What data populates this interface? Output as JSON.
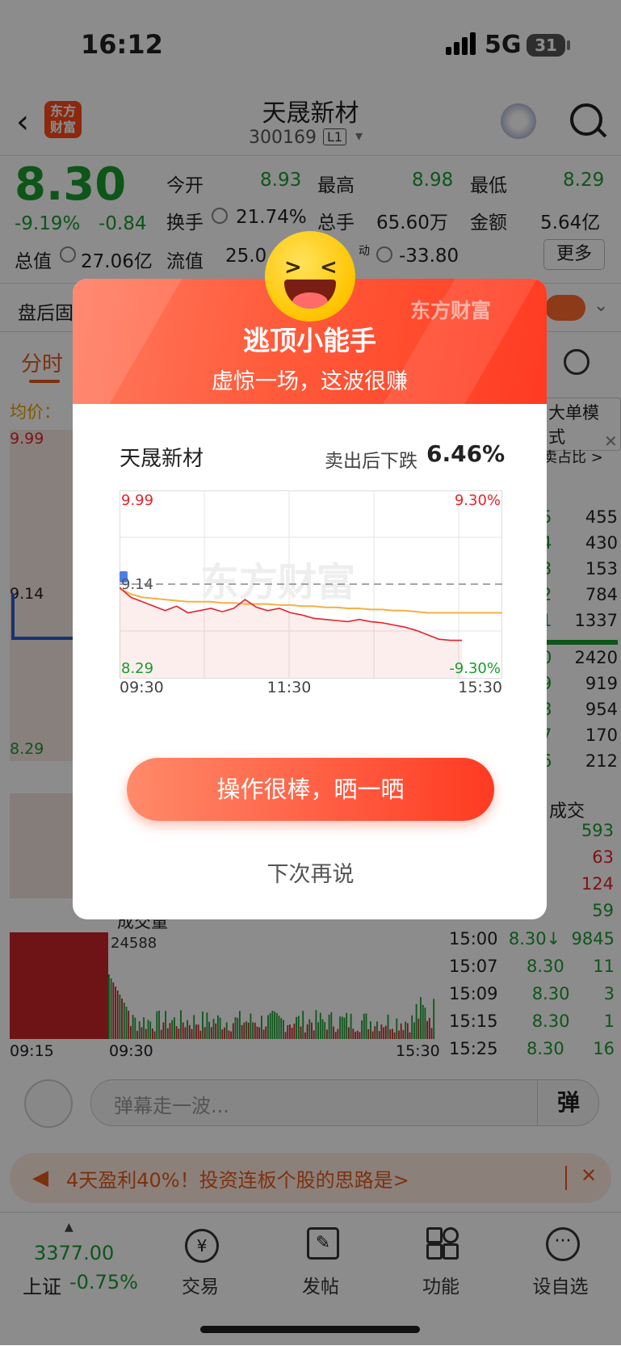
{
  "status_bar": {
    "time": "16:12",
    "network": "5G",
    "battery": "31"
  },
  "header": {
    "logo_text": "东方\n财富",
    "title": "天晟新材",
    "code": "300169",
    "level": "L1"
  },
  "quote": {
    "price": "8.30",
    "change_pct": "-9.19%",
    "change_val": "-0.84",
    "open_label": "今开",
    "open": "8.93",
    "high_label": "最高",
    "high": "8.98",
    "low_label": "最低",
    "low": "8.29",
    "turnover_label": "换手",
    "turnover": "21.74%",
    "volume_label": "总手",
    "volume": "65.60万",
    "amount_label": "金额",
    "amount": "5.64亿",
    "mktcap_label": "总值",
    "mktcap": "27.06亿",
    "float_label": "流值",
    "float": "25.0",
    "flow_label": "动",
    "flow": "-33.80",
    "more": "更多"
  },
  "behind": {
    "after_hours": "盘后固",
    "tab_timeshare": "分时",
    "avg_label": "均价：",
    "mode": "大单模式",
    "ratio": "卖占比 >",
    "y_top": "9.99",
    "y_mid": "9.14",
    "y_bot": "8.29",
    "vol_label": "成交量",
    "vol_max": "24588",
    "t_start": "09:15",
    "t_open": "09:30",
    "t_close": "15:30",
    "ask_vols": [
      "455",
      "430",
      "153",
      "784",
      "1337"
    ],
    "bid_vols": [
      "2420",
      "919",
      "954",
      "170",
      "212"
    ],
    "ask_digits": [
      "5",
      "4",
      "3",
      "2",
      "1"
    ],
    "bid_digits": [
      "0",
      "9",
      "8",
      "7",
      "6"
    ],
    "trades_label": "成交",
    "trades_top": [
      "593",
      "63",
      "124",
      "59"
    ],
    "trades": [
      {
        "time": "15:00",
        "price": "8.30↓",
        "vol": "9845"
      },
      {
        "time": "15:07",
        "price": "8.30",
        "vol": "11"
      },
      {
        "time": "15:09",
        "price": "8.30",
        "vol": "3"
      },
      {
        "time": "15:15",
        "price": "8.30",
        "vol": "1"
      },
      {
        "time": "15:25",
        "price": "8.30",
        "vol": "16"
      }
    ]
  },
  "dialog": {
    "brand": "东方财富",
    "title": "逃顶小能手",
    "subtitle": "虚惊一场，这波很赚",
    "stock_name": "天晟新材",
    "drop_label": "卖出后下跌",
    "drop_value": "6.46%",
    "button": "操作很棒，晒一晒",
    "later": "下次再说",
    "watermark": "东方财富"
  },
  "chart_data": {
    "type": "line",
    "x_labels": [
      "09:30",
      "11:30",
      "15:30"
    ],
    "y_max": "9.99",
    "y_min": "8.29",
    "y_ref": "9.14",
    "pct_max": "9.30%",
    "pct_min": "-9.30%",
    "ylim": [
      8.29,
      9.99
    ],
    "series": [
      {
        "values": [
          9.11,
          9.02,
          8.98,
          8.94,
          8.9,
          8.94,
          8.88,
          8.9,
          8.92,
          8.89,
          8.92,
          9.0,
          8.93,
          8.9,
          8.92,
          8.88,
          8.86,
          8.83,
          8.82,
          8.81,
          8.8,
          8.82,
          8.8,
          8.79,
          8.77,
          8.75,
          8.72,
          8.68,
          8.64,
          8.63,
          8.63
        ]
      },
      {
        "values": [
          9.1,
          9.05,
          9.02,
          9.01,
          9.0,
          8.99,
          8.98,
          8.98,
          8.98,
          8.97,
          8.97,
          8.96,
          8.96,
          8.96,
          8.95,
          8.95,
          8.94,
          8.94,
          8.93,
          8.93,
          8.92,
          8.92,
          8.91,
          8.91,
          8.9,
          8.9,
          8.89,
          8.88,
          8.88,
          8.88,
          8.88
        ]
      }
    ]
  },
  "comment": {
    "placeholder": "弹幕走一波...",
    "send": "弹"
  },
  "banner": {
    "text": "4天盈利40%！投资连板个股的思路是>"
  },
  "tabbar": {
    "index_value": "3377.00",
    "index_name": "上证",
    "index_change": "-0.75%",
    "trade": "交易",
    "post": "发帖",
    "func": "功能",
    "watch": "设自选"
  }
}
